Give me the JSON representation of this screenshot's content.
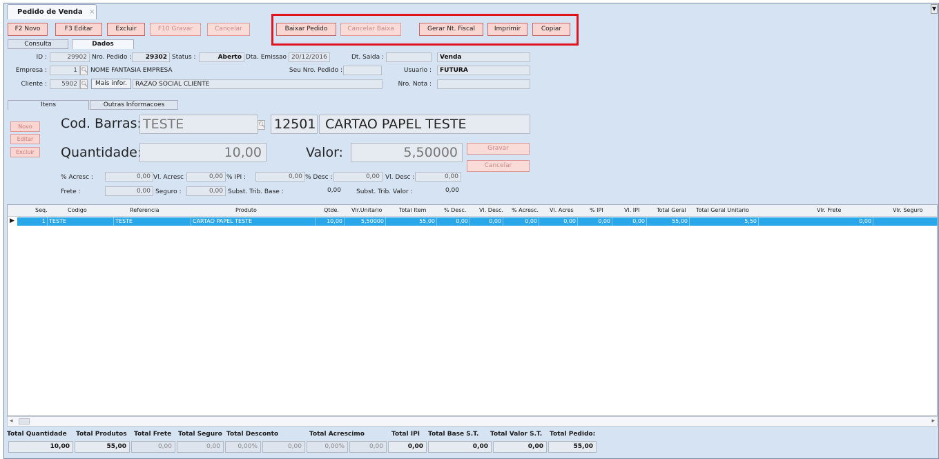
{
  "window": {
    "tab_title": "Pedido de Venda",
    "close_glyph": "×",
    "menu_glyph": "▼"
  },
  "toolbar": {
    "novo": "F2 Novo",
    "editar": "F3 Editar",
    "excluir": "Excluir",
    "gravar": "F10 Gravar",
    "cancelar": "Cancelar",
    "baixar_pedido": "Baixar Pedido",
    "cancelar_baixa": "Cancelar Baixa",
    "gerar_nf": "Gerar Nt. Fiscal",
    "imprimir": "Imprimir",
    "copiar": "Copiar"
  },
  "tabs": {
    "consulta": "Consulta",
    "dados": "Dados"
  },
  "header": {
    "id_label": "ID :",
    "id_value": "29902",
    "nro_pedido_label": "Nro. Pedido :",
    "nro_pedido_value": "29302",
    "status_label": "Status :",
    "status_value": "Aberto",
    "dta_emissao_label": "Dta. Emissao :",
    "dta_emissao_value": "20/12/2016",
    "dt_saida_label": "Dt. Saida :",
    "dt_saida_value": "",
    "tipo_value": "Venda",
    "empresa_label": "Empresa :",
    "empresa_code": "1",
    "empresa_name": "NOME FANTASIA EMPRESA",
    "seu_nro_pedido_label": "Seu Nro. Pedido :",
    "seu_nro_pedido_value": "",
    "usuario_label": "Usuario :",
    "usuario_value": "FUTURA",
    "cliente_label": "Cliente :",
    "cliente_code": "5902",
    "mais_infor": "Mais infor.",
    "cliente_name": "RAZAO SOCIAL CLIENTE",
    "nro_nota_label": "Nro. Nota :",
    "nro_nota_value": ""
  },
  "itemtabs": {
    "itens": "Itens",
    "outras": "Outras Informacoes"
  },
  "item": {
    "novo": "Novo",
    "editar": "Editar",
    "excluir": "Excluir",
    "cod_barras_label": "Cod. Barras:",
    "cod_barras_value": "TESTE",
    "codigo_value": "12501",
    "produto_value": "CARTAO PAPEL TESTE",
    "quantidade_label": "Quantidade:",
    "quantidade_value": "10,00",
    "valor_label": "Valor:",
    "valor_value": "5,50000",
    "gravar": "Gravar",
    "cancelar": "Cancelar",
    "acresc_label": "% Acresc :",
    "acresc_value": "0,00",
    "vl_acresc_label": "Vl. Acresc :",
    "vl_acresc_value": "0,00",
    "ipi_label": "% IPI :",
    "ipi_value": "0,00",
    "desc_label": "% Desc :",
    "desc_value": "0,00",
    "vl_desc_label": "Vl. Desc :",
    "vl_desc_value": "0,00",
    "frete_label": "Frete :",
    "frete_value": "0,00",
    "seguro_label": "Seguro :",
    "seguro_value": "0,00",
    "st_base_label": "Subst. Trib. Base :",
    "st_base_value": "0,00",
    "st_valor_label": "Subst. Trib. Valor :",
    "st_valor_value": "0,00"
  },
  "grid": {
    "columns": [
      "Seq.",
      "Codigo",
      "Referencia",
      "Produto",
      "Qtde.",
      "Vlr.Unitario",
      "Total Item",
      "% Desc.",
      "Vl. Desc.",
      "% Acresc.",
      "Vl. Acres",
      "% IPI",
      "Vl. IPI",
      "Total Geral",
      "Total Geral Unitario",
      "Vlr. Frete",
      "Vlr. Seguro"
    ],
    "rows": [
      [
        "1",
        "TESTE",
        "TESTE",
        "CARTAO PAPEL TESTE",
        "10,00",
        "5,50000",
        "55,00",
        "0,00",
        "0,00",
        "0,00",
        "0,00",
        "0,00",
        "0,00",
        "55,00",
        "5,50",
        "0,00",
        ""
      ]
    ],
    "row_marker": "▶"
  },
  "totals": {
    "labels": [
      "Total Quantidade",
      "Total Produtos",
      "Total Frete",
      "Total Seguro",
      "Total Desconto",
      "Total Acrescimo",
      "Total IPI",
      "Total Base S.T.",
      "Total Valor S.T.",
      "Total Pedido:"
    ],
    "quantidade": "10,00",
    "produtos": "55,00",
    "frete": "0,00",
    "seguro": "0,00",
    "desconto_pct": "0,00%",
    "desconto_val": "0,00",
    "acrescimo_pct": "0,00%",
    "acrescimo_val": "0,00",
    "ipi": "0,00",
    "base_st": "0,00",
    "valor_st": "0,00",
    "pedido": "55,00"
  },
  "colors": {
    "highlight": "#e0141e",
    "selected_row": "#29a7e8",
    "panel": "#d6e3f3"
  }
}
